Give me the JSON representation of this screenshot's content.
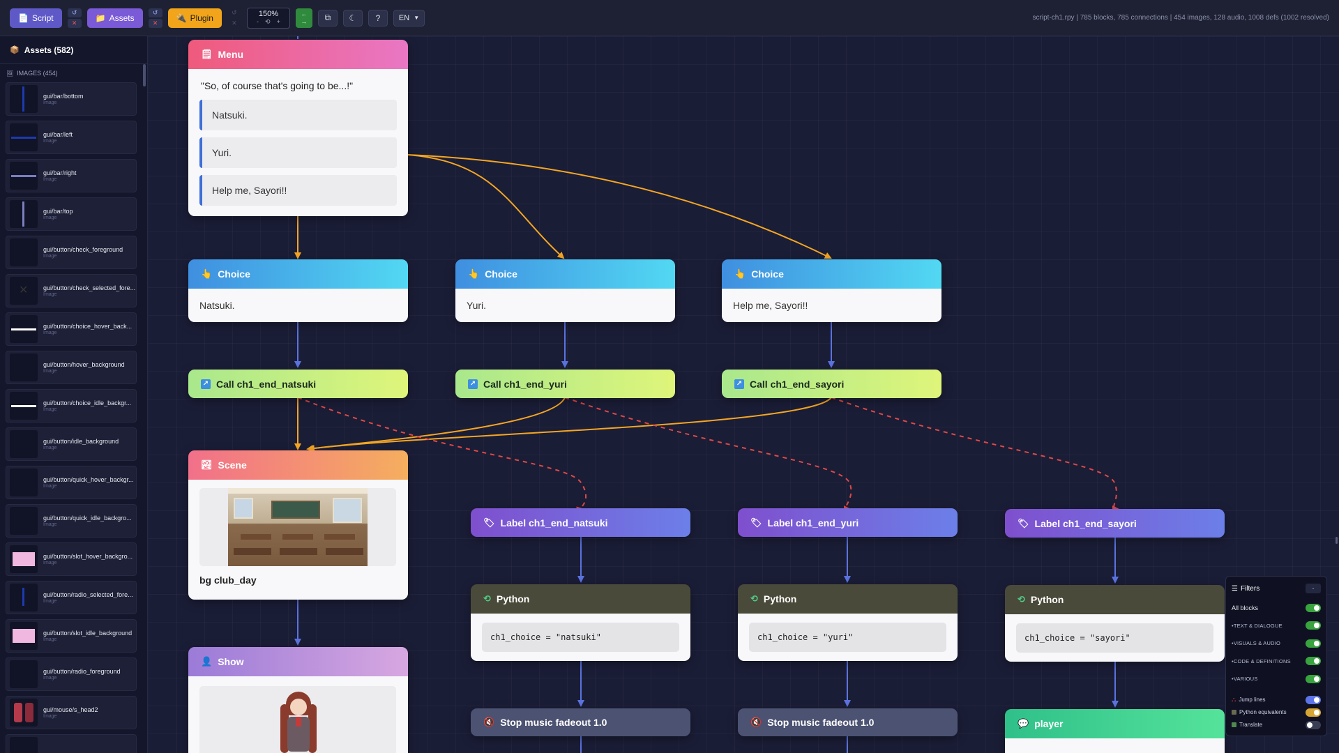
{
  "toolbar": {
    "script_label": "Script",
    "assets_label": "Assets",
    "plugin_label": "Plugin",
    "zoom": "150%",
    "zoom_minus": "-",
    "zoom_reset": "⟲",
    "zoom_plus": "+",
    "language": "EN",
    "help": "?",
    "stats": "script-ch1.rpy | 785 blocks, 785 connections | 454 images, 128 audio, 1008 defs (1002 resolved)"
  },
  "sidebar": {
    "title": "Assets (582)",
    "section": "IMAGES (454)",
    "items": [
      {
        "name": "gui/bar/bottom",
        "type": "Image"
      },
      {
        "name": "gui/bar/left",
        "type": "Image"
      },
      {
        "name": "gui/bar/right",
        "type": "Image"
      },
      {
        "name": "gui/bar/top",
        "type": "Image"
      },
      {
        "name": "gui/button/check_foreground",
        "type": "Image"
      },
      {
        "name": "gui/button/check_selected_fore...",
        "type": "Image"
      },
      {
        "name": "gui/button/choice_hover_back...",
        "type": "Image"
      },
      {
        "name": "gui/button/hover_background",
        "type": "Image"
      },
      {
        "name": "gui/button/choice_idle_backgr...",
        "type": "Image"
      },
      {
        "name": "gui/button/idle_background",
        "type": "Image"
      },
      {
        "name": "gui/button/quick_hover_backgr...",
        "type": "Image"
      },
      {
        "name": "gui/button/quick_idle_backgro...",
        "type": "Image"
      },
      {
        "name": "gui/button/slot_hover_backgro...",
        "type": "Image"
      },
      {
        "name": "gui/button/radio_selected_fore...",
        "type": "Image"
      },
      {
        "name": "gui/button/slot_idle_background",
        "type": "Image"
      },
      {
        "name": "gui/button/radio_foreground",
        "type": "Image"
      },
      {
        "name": "gui/mouse/s_head2",
        "type": "Image"
      }
    ]
  },
  "nodes": {
    "menu": {
      "title": "Menu",
      "question": "\"So, of course that's going to be...!\"",
      "options": [
        "Natsuki.",
        "Yuri.",
        "Help me, Sayori!!"
      ]
    },
    "choice_natsuki": {
      "title": "Choice",
      "text": "Natsuki."
    },
    "choice_yuri": {
      "title": "Choice",
      "text": "Yuri."
    },
    "choice_sayori": {
      "title": "Choice",
      "text": "Help me, Sayori!!"
    },
    "call_natsuki": {
      "title": "Call ch1_end_natsuki"
    },
    "call_yuri": {
      "title": "Call ch1_end_yuri"
    },
    "call_sayori": {
      "title": "Call ch1_end_sayori"
    },
    "scene": {
      "title": "Scene",
      "name": "bg club_day"
    },
    "show": {
      "title": "Show"
    },
    "label_natsuki": {
      "title": "Label ch1_end_natsuki"
    },
    "label_yuri": {
      "title": "Label ch1_end_yuri"
    },
    "label_sayori": {
      "title": "Label ch1_end_sayori"
    },
    "python_natsuki": {
      "title": "Python",
      "code": "ch1_choice = \"natsuki\""
    },
    "python_yuri": {
      "title": "Python",
      "code": "ch1_choice = \"yuri\""
    },
    "python_sayori": {
      "title": "Python",
      "code": "ch1_choice = \"sayori\""
    },
    "stop_1": {
      "title": "Stop music fadeout 1.0"
    },
    "stop_2": {
      "title": "Stop music fadeout 1.0"
    },
    "player": {
      "title": "player"
    }
  },
  "filters": {
    "title": "Filters",
    "minimize": "-",
    "all_blocks": "All blocks",
    "text_dialogue": "•TEXT & DIALOGUE",
    "visuals_audio": "•VISUALS & AUDIO",
    "code_defs": "•CODE & DEFINITIONS",
    "various": "•VARIOUS",
    "jump_lines": "Jump lines",
    "python_equivalents": "Python equivalents",
    "translate": "Translate"
  },
  "colors": {
    "edge_flow": "#f5a623",
    "edge_next": "#5b73e0",
    "edge_call": "#e04848",
    "canvas_bg": "#1a1d36"
  }
}
